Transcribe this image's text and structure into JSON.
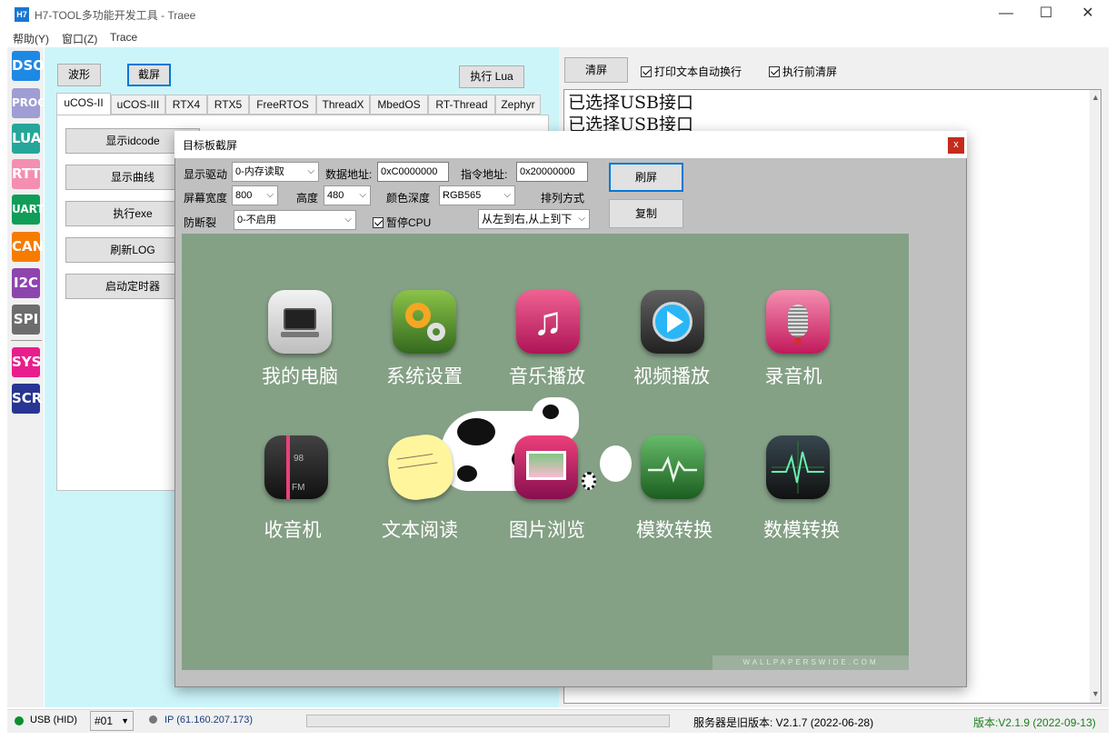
{
  "window": {
    "icon_text": "H7",
    "title": "H7-TOOL多功能开发工具 - Traee",
    "minimize": "—",
    "maximize": "☐",
    "close": "✕"
  },
  "menu": [
    "帮助(Y)",
    "窗口(Z)",
    "Trace"
  ],
  "sidebar": [
    {
      "label": "DSO",
      "color": "#1e88e5"
    },
    {
      "label": "PROG",
      "color": "#9e9ed4"
    },
    {
      "label": "LUA",
      "color": "#26a69a"
    },
    {
      "label": "RTT",
      "color": "#f48fb1"
    },
    {
      "label": "UART",
      "color": "#0f9d58"
    },
    {
      "label": "CAN",
      "color": "#f57c00"
    },
    {
      "label": "I2C",
      "color": "#8e44ad"
    },
    {
      "label": "SPI",
      "color": "#6d6d6d"
    },
    {
      "label": "SYS",
      "color": "#e91e8c"
    },
    {
      "label": "SCR",
      "color": "#283593"
    }
  ],
  "mid": {
    "wave_button": "波形",
    "screenshot_button": "截屏",
    "run_lua_button": "执行 Lua",
    "tabs": [
      "uCOS-II",
      "uCOS-III",
      "RTX4",
      "RTX5",
      "FreeRTOS",
      "ThreadX",
      "MbedOS",
      "RT-Thread",
      "Zephyr"
    ],
    "actions": [
      "显示idcode",
      "显示曲线",
      "执行exe",
      "刷新LOG",
      "启动定时器"
    ]
  },
  "right": {
    "clear_button": "清屏",
    "auto_wrap": "打印文本自动换行",
    "clear_before_run": "执行前清屏",
    "output_lines": [
      "已选择USB接口",
      "已选择USB接口"
    ]
  },
  "dialog": {
    "title": "目标板截屏",
    "close": "x",
    "driver_label": "显示驱动",
    "driver_value": "0-内存读取",
    "data_addr_label": "数据地址:",
    "data_addr_value": "0xC0000000",
    "cmd_addr_label": "指令地址:",
    "cmd_addr_value": "0x20000000",
    "refresh_button": "刷屏",
    "width_label": "屏幕宽度",
    "width_value": "800",
    "height_label": "高度",
    "height_value": "480",
    "color_depth_label": "颜色深度",
    "color_depth_value": "RGB565",
    "order_label": "排列方式",
    "copy_button": "复制",
    "tear_label": "防断裂",
    "tear_value": "0-不启用",
    "pause_cpu": "暂停CPU",
    "order_value": "从左到右,从上到下"
  },
  "screen": {
    "apps_row1": [
      "我的电脑",
      "系统设置",
      "音乐播放",
      "视频播放",
      "录音机"
    ],
    "apps_row2": [
      "收音机",
      "文本阅读",
      "图片浏览",
      "模数转换",
      "数模转换"
    ],
    "watermark": "WALLPAPERSWIDE.COM",
    "radio_freq": "98",
    "radio_band": "FM"
  },
  "status": {
    "usb": "USB (HID)",
    "device": "#01",
    "ip": "IP (61.160.207.173)",
    "server": "服务器是旧版本: V2.1.7 (2022-06-28)",
    "version": "版本:V2.1.9 (2022-09-13)"
  }
}
